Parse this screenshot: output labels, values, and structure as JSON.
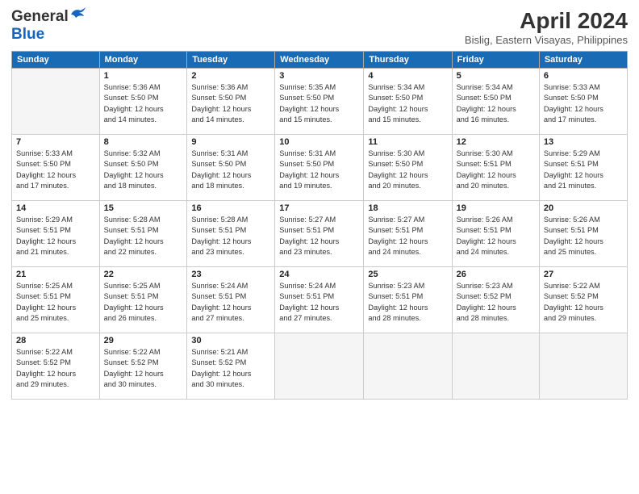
{
  "header": {
    "logo_general": "General",
    "logo_blue": "Blue",
    "title": "April 2024",
    "subtitle": "Bislig, Eastern Visayas, Philippines"
  },
  "calendar": {
    "headers": [
      "Sunday",
      "Monday",
      "Tuesday",
      "Wednesday",
      "Thursday",
      "Friday",
      "Saturday"
    ],
    "weeks": [
      [
        {
          "num": "",
          "info": ""
        },
        {
          "num": "1",
          "info": "Sunrise: 5:36 AM\nSunset: 5:50 PM\nDaylight: 12 hours\nand 14 minutes."
        },
        {
          "num": "2",
          "info": "Sunrise: 5:36 AM\nSunset: 5:50 PM\nDaylight: 12 hours\nand 14 minutes."
        },
        {
          "num": "3",
          "info": "Sunrise: 5:35 AM\nSunset: 5:50 PM\nDaylight: 12 hours\nand 15 minutes."
        },
        {
          "num": "4",
          "info": "Sunrise: 5:34 AM\nSunset: 5:50 PM\nDaylight: 12 hours\nand 15 minutes."
        },
        {
          "num": "5",
          "info": "Sunrise: 5:34 AM\nSunset: 5:50 PM\nDaylight: 12 hours\nand 16 minutes."
        },
        {
          "num": "6",
          "info": "Sunrise: 5:33 AM\nSunset: 5:50 PM\nDaylight: 12 hours\nand 17 minutes."
        }
      ],
      [
        {
          "num": "7",
          "info": "Sunrise: 5:33 AM\nSunset: 5:50 PM\nDaylight: 12 hours\nand 17 minutes."
        },
        {
          "num": "8",
          "info": "Sunrise: 5:32 AM\nSunset: 5:50 PM\nDaylight: 12 hours\nand 18 minutes."
        },
        {
          "num": "9",
          "info": "Sunrise: 5:31 AM\nSunset: 5:50 PM\nDaylight: 12 hours\nand 18 minutes."
        },
        {
          "num": "10",
          "info": "Sunrise: 5:31 AM\nSunset: 5:50 PM\nDaylight: 12 hours\nand 19 minutes."
        },
        {
          "num": "11",
          "info": "Sunrise: 5:30 AM\nSunset: 5:50 PM\nDaylight: 12 hours\nand 20 minutes."
        },
        {
          "num": "12",
          "info": "Sunrise: 5:30 AM\nSunset: 5:51 PM\nDaylight: 12 hours\nand 20 minutes."
        },
        {
          "num": "13",
          "info": "Sunrise: 5:29 AM\nSunset: 5:51 PM\nDaylight: 12 hours\nand 21 minutes."
        }
      ],
      [
        {
          "num": "14",
          "info": "Sunrise: 5:29 AM\nSunset: 5:51 PM\nDaylight: 12 hours\nand 21 minutes."
        },
        {
          "num": "15",
          "info": "Sunrise: 5:28 AM\nSunset: 5:51 PM\nDaylight: 12 hours\nand 22 minutes."
        },
        {
          "num": "16",
          "info": "Sunrise: 5:28 AM\nSunset: 5:51 PM\nDaylight: 12 hours\nand 23 minutes."
        },
        {
          "num": "17",
          "info": "Sunrise: 5:27 AM\nSunset: 5:51 PM\nDaylight: 12 hours\nand 23 minutes."
        },
        {
          "num": "18",
          "info": "Sunrise: 5:27 AM\nSunset: 5:51 PM\nDaylight: 12 hours\nand 24 minutes."
        },
        {
          "num": "19",
          "info": "Sunrise: 5:26 AM\nSunset: 5:51 PM\nDaylight: 12 hours\nand 24 minutes."
        },
        {
          "num": "20",
          "info": "Sunrise: 5:26 AM\nSunset: 5:51 PM\nDaylight: 12 hours\nand 25 minutes."
        }
      ],
      [
        {
          "num": "21",
          "info": "Sunrise: 5:25 AM\nSunset: 5:51 PM\nDaylight: 12 hours\nand 25 minutes."
        },
        {
          "num": "22",
          "info": "Sunrise: 5:25 AM\nSunset: 5:51 PM\nDaylight: 12 hours\nand 26 minutes."
        },
        {
          "num": "23",
          "info": "Sunrise: 5:24 AM\nSunset: 5:51 PM\nDaylight: 12 hours\nand 27 minutes."
        },
        {
          "num": "24",
          "info": "Sunrise: 5:24 AM\nSunset: 5:51 PM\nDaylight: 12 hours\nand 27 minutes."
        },
        {
          "num": "25",
          "info": "Sunrise: 5:23 AM\nSunset: 5:51 PM\nDaylight: 12 hours\nand 28 minutes."
        },
        {
          "num": "26",
          "info": "Sunrise: 5:23 AM\nSunset: 5:52 PM\nDaylight: 12 hours\nand 28 minutes."
        },
        {
          "num": "27",
          "info": "Sunrise: 5:22 AM\nSunset: 5:52 PM\nDaylight: 12 hours\nand 29 minutes."
        }
      ],
      [
        {
          "num": "28",
          "info": "Sunrise: 5:22 AM\nSunset: 5:52 PM\nDaylight: 12 hours\nand 29 minutes."
        },
        {
          "num": "29",
          "info": "Sunrise: 5:22 AM\nSunset: 5:52 PM\nDaylight: 12 hours\nand 30 minutes."
        },
        {
          "num": "30",
          "info": "Sunrise: 5:21 AM\nSunset: 5:52 PM\nDaylight: 12 hours\nand 30 minutes."
        },
        {
          "num": "",
          "info": ""
        },
        {
          "num": "",
          "info": ""
        },
        {
          "num": "",
          "info": ""
        },
        {
          "num": "",
          "info": ""
        }
      ]
    ]
  }
}
